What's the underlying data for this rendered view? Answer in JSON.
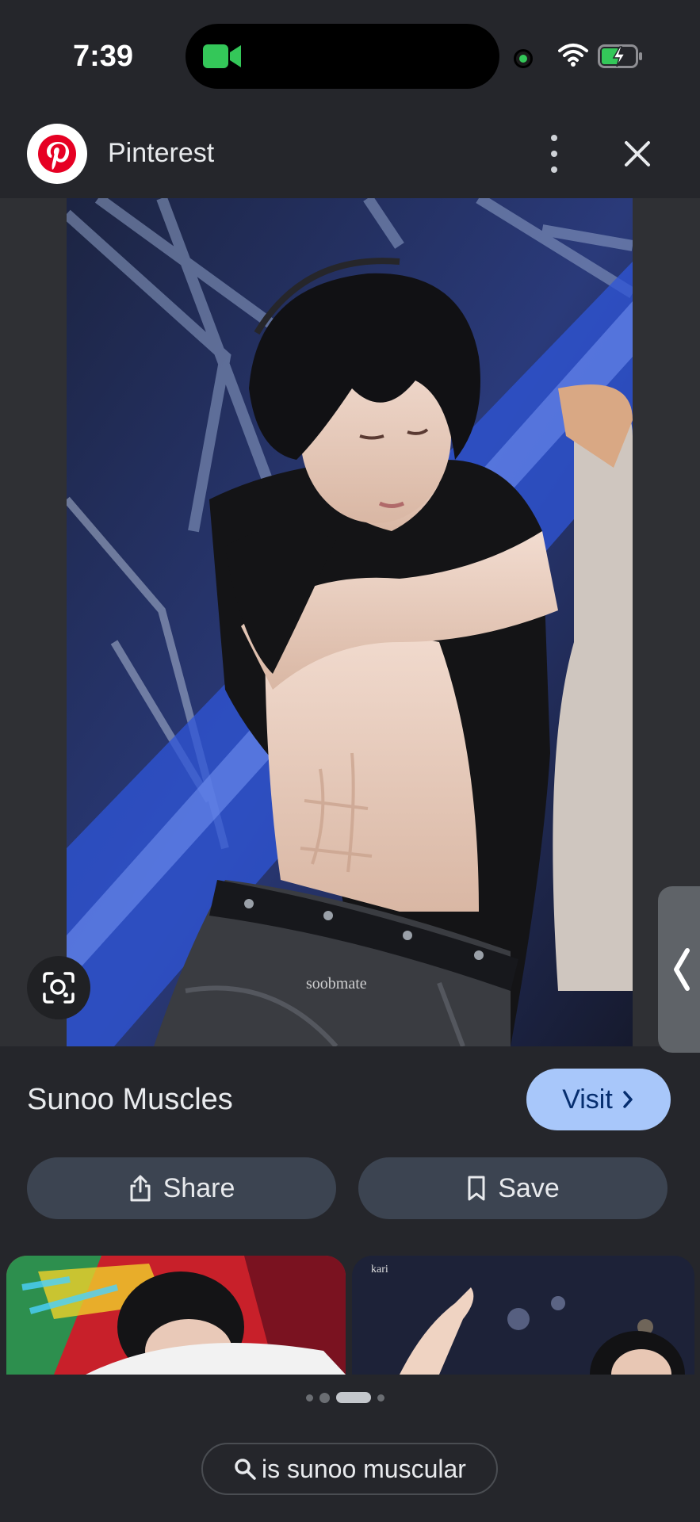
{
  "status_bar": {
    "time": "7:39",
    "icons": [
      "facetime-video-icon",
      "green-indicator-dot",
      "wifi-icon",
      "battery-charging-icon"
    ],
    "indicator_color": "#34c759"
  },
  "header": {
    "site_name": "Pinterest",
    "logo_icon": "pinterest-logo",
    "more_icon": "more-vert-icon",
    "close_icon": "close-icon",
    "brand_color": "#e60023"
  },
  "viewer": {
    "watermark": "soobmate",
    "lens_icon": "google-lens-icon",
    "side_tab_icon": "chevron-left-icon"
  },
  "result": {
    "title": "Sunoo Muscles",
    "visit_label": "Visit",
    "share_label": "Share",
    "save_label": "Save",
    "accent_color": "#a8c7fa"
  },
  "related": {
    "items": [
      {
        "label": ""
      },
      {
        "label": "kari"
      }
    ]
  },
  "pagination": {
    "total": 4,
    "active": 3
  },
  "search_chip": {
    "label": "is sunoo muscular"
  }
}
